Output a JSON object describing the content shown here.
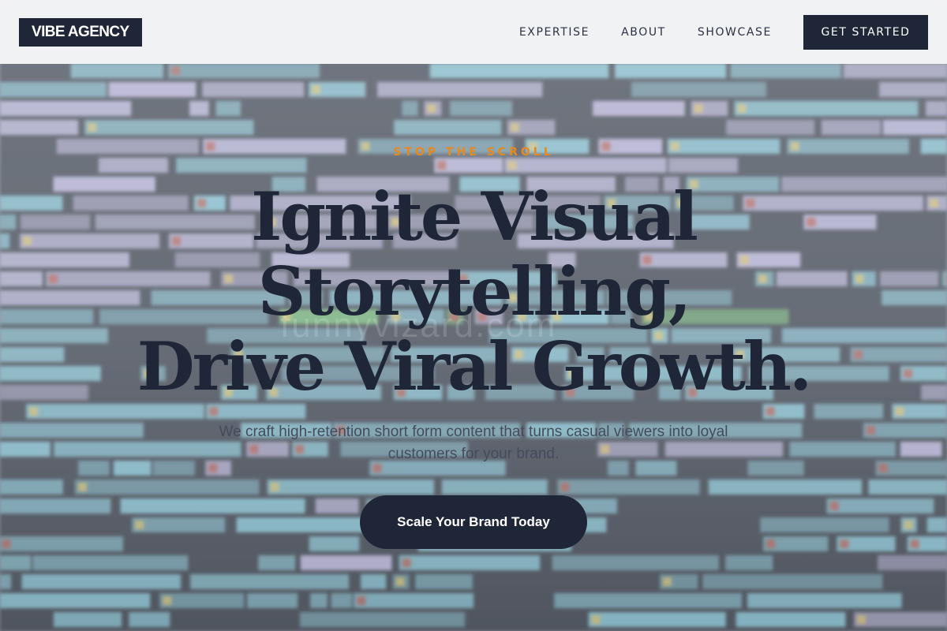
{
  "brand": {
    "logo_text": "VIBE AGENCY"
  },
  "nav": {
    "links": [
      "EXPERTISE",
      "ABOUT",
      "SHOWCASE"
    ],
    "cta_label": "GET STARTED"
  },
  "hero": {
    "eyebrow": "STOP THE SCROLL",
    "headline_lines": [
      "Ignite Visual",
      "Storytelling,",
      "Drive Viral Growth."
    ],
    "subtitle": "We craft high-retention short form content that turns casual viewers into loyal customers for your brand.",
    "cta_label": "Scale Your Brand Today"
  },
  "colors": {
    "navy": "#1e2638",
    "accent_orange": "#e8891e",
    "timeline_cyan": "#8fd6e6",
    "timeline_lavender": "#cdc6ee",
    "timeline_green": "#7fcf7a"
  }
}
